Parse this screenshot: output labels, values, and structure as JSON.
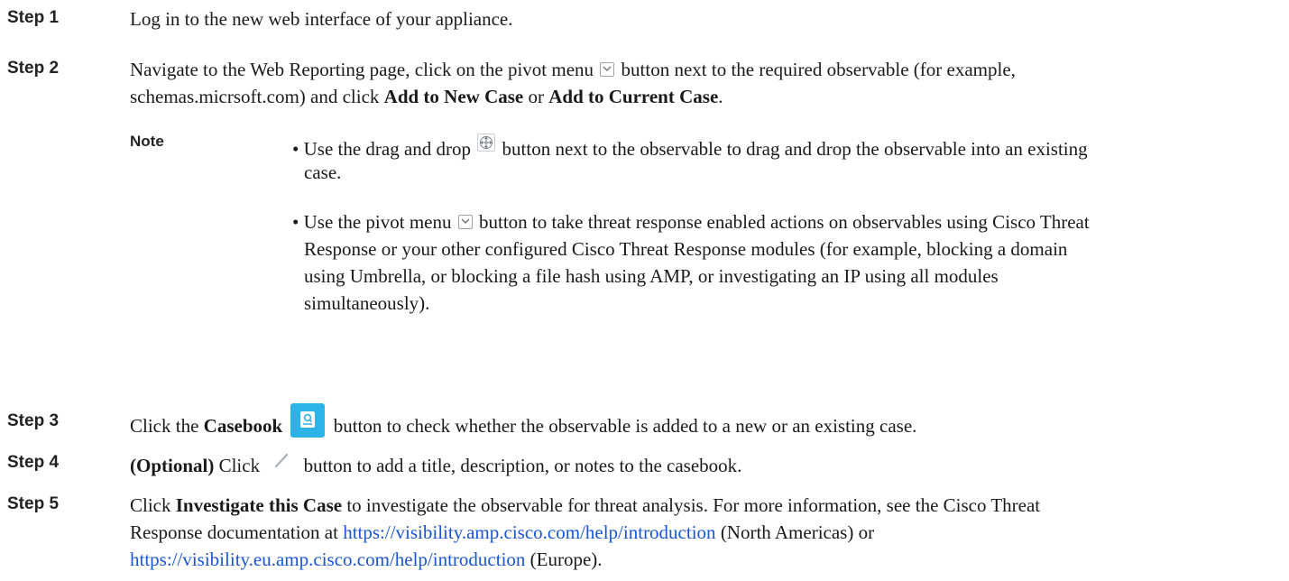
{
  "steps": [
    {
      "label": "Step 1",
      "line1": "Log in to the new web interface of your appliance."
    },
    {
      "label": "Step 2",
      "line1_a": "Navigate to the Web Reporting page, click on the pivot menu",
      "line1_b": "button next to the required observable (for example,",
      "line2_a": "schemas.micrsoft.com) and click ",
      "line2_b": "Add to New Case",
      "line2_c": " or ",
      "line2_d": "Add to Current Case",
      "line2_e": "."
    },
    {
      "label": "Step 3",
      "a": "Click the ",
      "b": "Casebook",
      "c": "button to check whether the observable is added to a new or an existing case."
    },
    {
      "label": "Step 4",
      "a": "(Optional)",
      "b": " Click",
      "c": "button to add a title, description, or notes to the casebook."
    },
    {
      "label": "Step 5",
      "line1_a": "Click ",
      "line1_b": "Investigate this Case",
      "line1_c": " to investigate the observable for threat analysis. For more information, see the Cisco Threat",
      "line2_a": "Response documentation at ",
      "line2_link": "https://visibility.amp.cisco.com/help/introduction",
      "line2_c": " (North Americas) or",
      "line3_link": "https://visibility.eu.amp.cisco.com/help/introduction",
      "line3_c": " (Europe)."
    }
  ],
  "note": {
    "label": "Note",
    "bullet1_a": "• Use the drag and drop",
    "bullet1_b": "button next to the observable to drag and drop the observable into an existing",
    "bullet1_cont": "case.",
    "bullet2_a": "• Use the pivot menu",
    "bullet2_b": "button to take threat response enabled actions on observables using Cisco Threat",
    "bullet2_l2": "Response or your other configured Cisco Threat Response modules (for example, blocking a domain",
    "bullet2_l3": "using Umbrella, or blocking a file hash using AMP, or investigating an IP using all modules",
    "bullet2_l4": "simultaneously)."
  },
  "icons": {
    "pivot": "chevron-down-icon",
    "drag": "move-arrows-icon",
    "casebook": "casebook-icon",
    "pencil": "pencil-icon"
  },
  "colors": {
    "link": "#1a55d6",
    "casebook_bg": "#2cb3e8"
  }
}
